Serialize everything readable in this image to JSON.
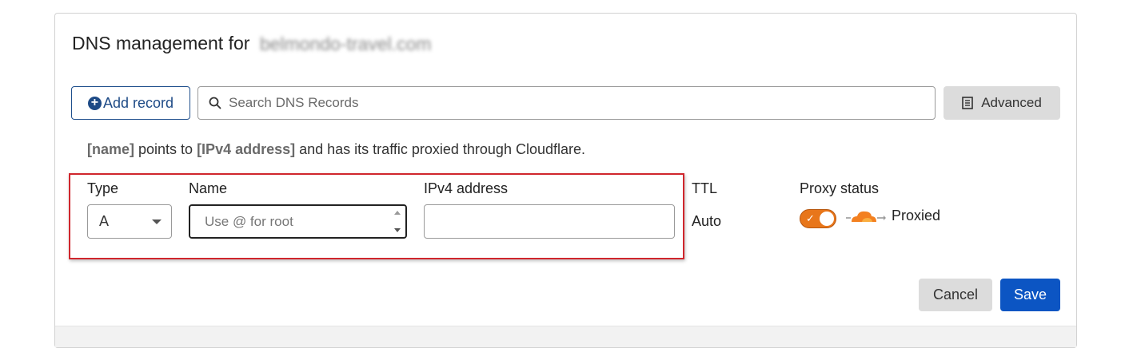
{
  "header": {
    "title": "DNS management for",
    "domain": "belmondo-travel.com"
  },
  "toolbar": {
    "add_record_label": "Add record",
    "search_placeholder": "Search DNS Records",
    "advanced_label": "Advanced"
  },
  "notice": {
    "name_token": "[name]",
    "points_to": " points to ",
    "target_token": "[IPv4 address]",
    "rest": " and has its traffic proxied through Cloudflare."
  },
  "form": {
    "type_label": "Type",
    "type_value": "A",
    "name_label": "Name",
    "name_placeholder": "Use @ for root",
    "ipv4_label": "IPv4 address",
    "ipv4_value": "",
    "ttl_label": "TTL",
    "ttl_value": "Auto",
    "proxy_label": "Proxy status",
    "proxy_on": true,
    "proxy_value": "Proxied"
  },
  "actions": {
    "cancel_label": "Cancel",
    "save_label": "Save"
  },
  "colors": {
    "accent_blue": "#0c55c3",
    "outline_blue": "#1d4a86",
    "proxy_orange": "#e8761a",
    "highlight_red": "#d0262d"
  },
  "icons": {
    "add": "plus-circle-icon",
    "search": "search-icon",
    "advanced": "document-icon",
    "type_select": "chevron-down-icon",
    "proxy": "cloud-icon"
  }
}
